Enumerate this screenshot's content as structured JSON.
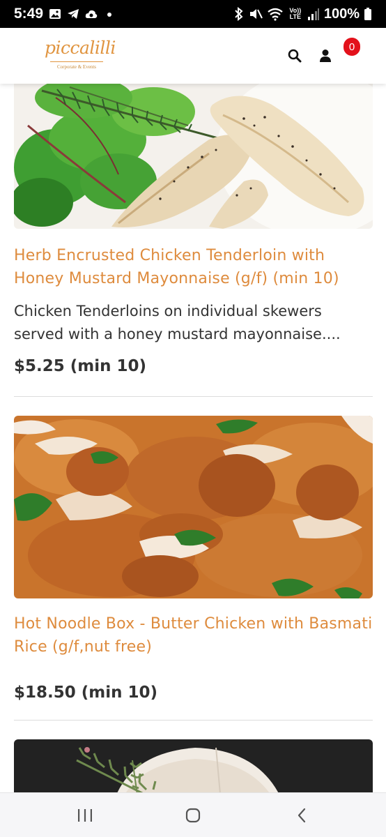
{
  "status_bar": {
    "time": "5:49",
    "battery": "100%",
    "icons": [
      "gallery-icon",
      "telegram-icon",
      "cloud-icon",
      "dot-icon",
      "bluetooth-icon",
      "mute-icon",
      "wifi-icon",
      "volte-icon",
      "signal-icon",
      "battery-icon"
    ],
    "volte_label": "Vo)) LTE"
  },
  "header": {
    "logo_text": "piccalilli",
    "logo_subtext": "Corporate & Events",
    "cart_count": "0",
    "colors": {
      "brand": "#e0943f",
      "badge": "#e3111b"
    }
  },
  "products": [
    {
      "title": "Herb Encrusted Chicken Tenderloin with Honey Mustard Mayonnaise (g/f) (min 10)",
      "description": "Chicken Tenderloins on individual skewers served with a honey mustard mayonnaise....",
      "price": "$5.25 (min 10)"
    },
    {
      "title": "Hot Noodle Box - Butter Chicken with Basmati Rice (g/f,nut free)",
      "description": "",
      "price": "$18.50 (min 10)"
    }
  ],
  "nav_bar": {
    "buttons": [
      "recent-apps",
      "home",
      "back"
    ]
  }
}
